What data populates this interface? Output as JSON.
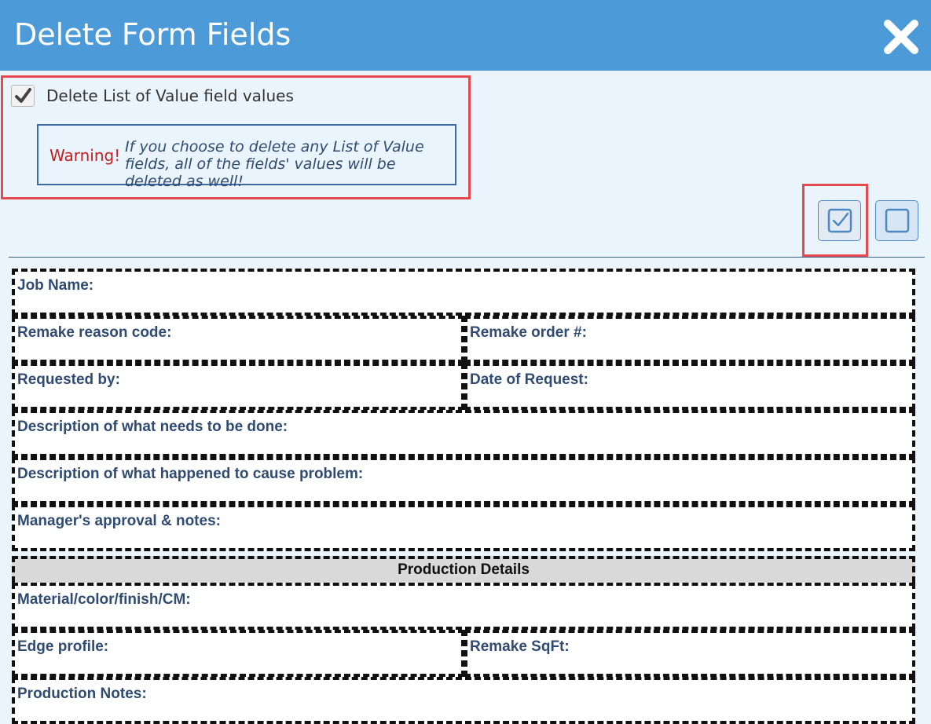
{
  "dialog": {
    "title": "Delete Form Fields"
  },
  "option": {
    "label": "Delete List of Value field values",
    "checked": true
  },
  "warning": {
    "tag": "Warning!",
    "text": "If you choose to delete any List of Value fields, all of the fields' values will be deleted as well!"
  },
  "form": {
    "fields": [
      "Job Name:",
      "Remake reason code:",
      "Remake order #:",
      "Requested by:",
      "Date of Request:",
      "Description of what needs to be done:",
      "Description of what happened to cause problem:",
      "Manager's approval & notes:",
      "Material/color/finish/CM:",
      "Edge profile:",
      "Remake SqFt:",
      "Production Notes:"
    ],
    "section_title": "Production Details"
  },
  "icons": {
    "close": "close-icon",
    "select_all": "checkbox-checked-icon",
    "select_none": "checkbox-empty-icon"
  },
  "colors": {
    "header": "#4d9ad8",
    "highlight": "#e5484d",
    "warning": "#c41e1e",
    "label": "#2f4b72"
  }
}
